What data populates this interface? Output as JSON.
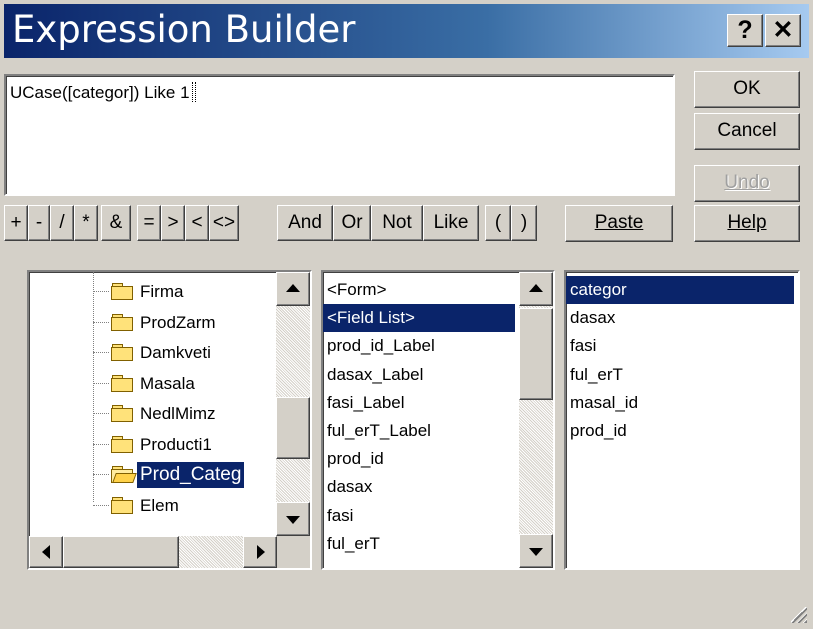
{
  "window": {
    "title": "Expression Builder",
    "help_label": "?",
    "close_label": "✕"
  },
  "expression": {
    "value": "UCase([categor]) Like 1"
  },
  "buttons": {
    "ok": "OK",
    "cancel": "Cancel",
    "undo": "Undo",
    "paste": "Paste",
    "help": "Help"
  },
  "operators": [
    "+",
    "-",
    "/",
    "*",
    "&",
    "=",
    ">",
    "<",
    "<>",
    "And",
    "Or",
    "Not",
    "Like",
    "(",
    ")"
  ],
  "tree": {
    "items": [
      {
        "label": "Firma",
        "icon": "folder-icon"
      },
      {
        "label": "ProdZarm",
        "icon": "folder-icon"
      },
      {
        "label": "Damkveti",
        "icon": "folder-icon"
      },
      {
        "label": "Masala",
        "icon": "folder-icon"
      },
      {
        "label": "NedlMimz",
        "icon": "folder-icon"
      },
      {
        "label": "Producti1",
        "icon": "folder-icon"
      },
      {
        "label": "Prod_Categ",
        "icon": "open-folder-icon",
        "selected": true
      },
      {
        "label": "Elem",
        "icon": "folder-icon"
      }
    ]
  },
  "middle_list": {
    "items": [
      "<Form>",
      "<Field List>",
      "prod_id_Label",
      "dasax_Label",
      "fasi_Label",
      "ful_erT_Label",
      "prod_id",
      "dasax",
      "fasi",
      "ful_erT"
    ],
    "selected_index": 1
  },
  "right_list": {
    "items": [
      "categor",
      "dasax",
      "fasi",
      "ful_erT",
      "masal_id",
      "prod_id"
    ],
    "selected_index": 0
  },
  "colors": {
    "selection": "#0a246a",
    "face": "#d4d0c8",
    "title_start": "#0a246a",
    "title_end": "#a6caf0"
  },
  "icons": {
    "scroll_up": "up-arrow-icon",
    "scroll_down": "down-arrow-icon",
    "scroll_left": "left-arrow-icon",
    "scroll_right": "right-arrow-icon",
    "resize": "resize-grip-icon"
  }
}
